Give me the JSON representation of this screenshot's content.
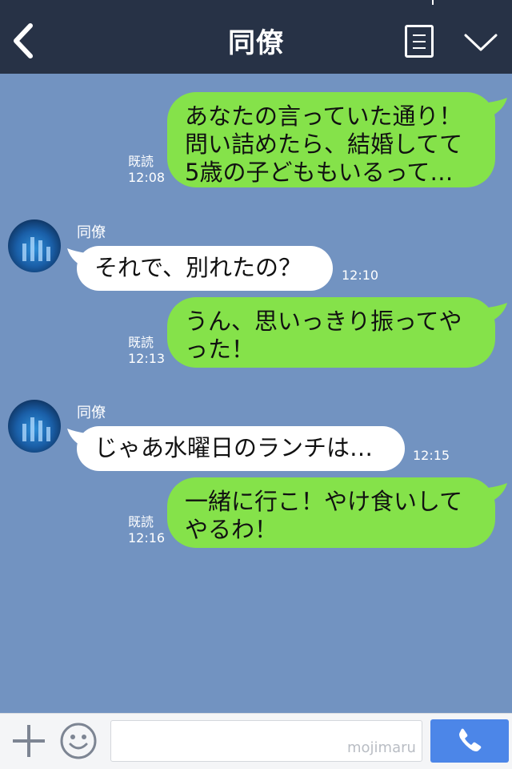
{
  "header": {
    "title": "同僚",
    "back_icon": "chevron-left-icon",
    "menu_icon": "notes-icon",
    "more_icon": "chevron-down-icon",
    "bg_color": "#273246"
  },
  "chat": {
    "bg_color": "#7293c1",
    "me_bubble_color": "#85e24a",
    "them_bubble_color": "#ffffff",
    "messages": [
      {
        "from": "me",
        "text": "あなたの言っていた通り！\n問い詰めたら、結婚してて\n5歳の子どももいるって…",
        "read": "既読",
        "time": "12:08"
      },
      {
        "from": "them",
        "sender": "同僚",
        "text": "それで、別れたの？",
        "time": "12:10"
      },
      {
        "from": "me",
        "text": "うん、思いっきり振ってや\nった！",
        "read": "既読",
        "time": "12:13"
      },
      {
        "from": "them",
        "sender": "同僚",
        "text": "じゃあ水曜日のランチは…",
        "time": "12:15"
      },
      {
        "from": "me",
        "text": "一緒に行こ！やけ食いして\nやるわ！",
        "read": "既読",
        "time": "12:16"
      }
    ]
  },
  "input_bar": {
    "plus_icon": "plus-icon",
    "emoji_icon": "smiley-icon",
    "input_value": "",
    "watermark": "mojimaru",
    "call_icon": "phone-icon",
    "call_color": "#4c86e8"
  }
}
